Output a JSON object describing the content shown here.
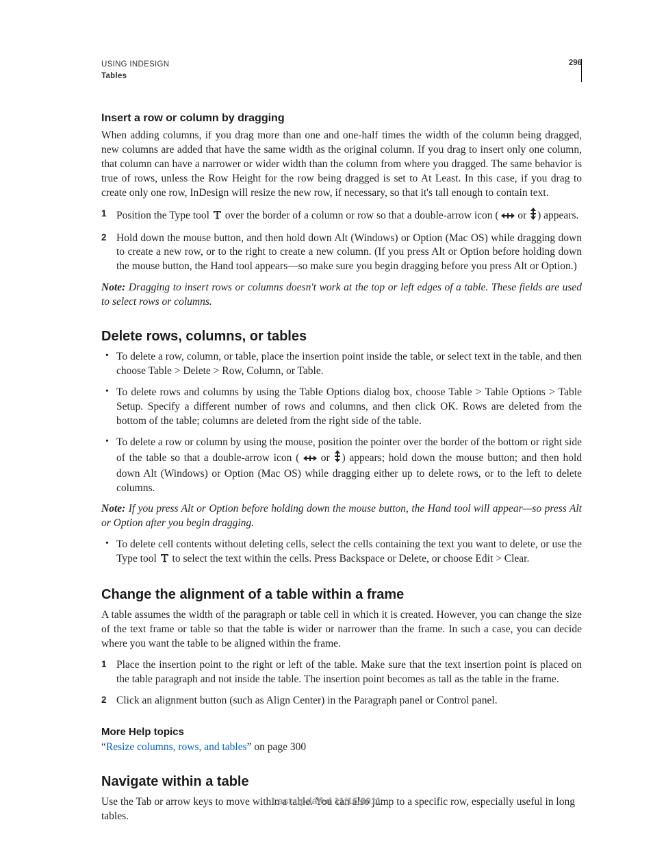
{
  "header": {
    "product": "USING INDESIGN",
    "section": "Tables",
    "page_number": "296"
  },
  "s1": {
    "heading": "Insert a row or column by dragging",
    "intro": "When adding columns, if you drag more than one and one-half times the width of the column being dragged, new columns are added that have the same width as the original column. If you drag to insert only one column, that column can have a narrower or wider width than the column from where you dragged. The same behavior is true of rows, unless the Row Height for the row being dragged is set to At Least. In this case, if you drag to create only one row, InDesign will resize the new row, if necessary, so that it's tall enough to contain text.",
    "step1_a": "Position the Type tool ",
    "step1_b": " over the border of a column or row so that a double-arrow icon ( ",
    "step1_c": " or ",
    "step1_d": ") appears.",
    "step2": "Hold down the mouse button, and then hold down Alt (Windows) or Option (Mac OS) while dragging down to create a new row, or to the right to create a new column. (If you press Alt or Option before holding down the mouse button, the Hand tool appears—so make sure you begin dragging before you press Alt or Option.)",
    "note_label": "Note:",
    "note": " Dragging to insert rows or columns doesn't work at the top or left edges of a table. These fields are used to select rows or columns."
  },
  "s2": {
    "heading": "Delete rows, columns, or tables",
    "b1": "To delete a row, column, or table, place the insertion point inside the table, or select text in the table, and then choose Table > Delete > Row, Column, or Table.",
    "b2": "To delete rows and columns by using the Table Options dialog box, choose Table > Table Options > Table Setup. Specify a different number of rows and columns, and then click OK. Rows are deleted from the bottom of the table; columns are deleted from the right side of the table.",
    "b3_a": "To delete a row or column by using the mouse, position the pointer over the border of the bottom or right side of the table so that a double-arrow icon ( ",
    "b3_b": " or ",
    "b3_c": ") appears; hold down the mouse button; and then hold down Alt (Windows) or Option (Mac OS) while dragging either up to delete rows, or to the left to delete columns.",
    "note_label": "Note:",
    "note": " If you press Alt or Option before holding down the mouse button, the Hand tool will appear—so press Alt or Option after you begin dragging.",
    "b4_a": "To delete cell contents without deleting cells, select the cells containing the text you want to delete, or use the Type tool ",
    "b4_b": " to select the text within the cells. Press Backspace or Delete, or choose Edit > Clear."
  },
  "s3": {
    "heading": "Change the alignment of a table within a frame",
    "intro": "A table assumes the width of the paragraph or table cell in which it is created. However, you can change the size of the text frame or table so that the table is wider or narrower than the frame. In such a case, you can decide where you want the table to be aligned within the frame.",
    "step1": "Place the insertion point to the right or left of the table. Make sure that the text insertion point is placed on the table paragraph and not inside the table. The insertion point becomes as tall as the table in the frame.",
    "step2": "Click an alignment button (such as Align Center) in the Paragraph panel or Control panel."
  },
  "morehelp": {
    "heading": "More Help topics",
    "q_open": "“",
    "link_text": "Resize columns, rows, and tables",
    "q_close_rest": "” on page 300"
  },
  "s4": {
    "heading": "Navigate within a table",
    "intro": "Use the Tab or arrow keys to move within a table. You can also jump to a specific row, especially useful in long tables."
  },
  "footer": {
    "text": "Last updated 11/16/2011"
  }
}
